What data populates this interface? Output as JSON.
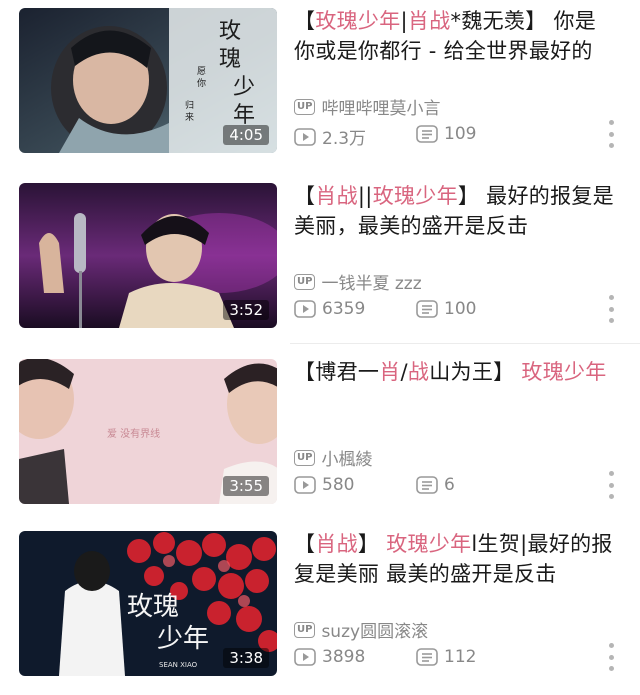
{
  "videos": [
    {
      "title_parts": [
        {
          "text": "【",
          "hl": false
        },
        {
          "text": "玫瑰少年",
          "hl": true
        },
        {
          "text": "|",
          "hl": false
        },
        {
          "text": "肖战",
          "hl": true
        },
        {
          "text": "*魏无羡】 你是你或是你都行 - 给全世界最好的",
          "hl": false
        }
      ],
      "duration": "4:05",
      "uploader": "哔哩哔哩莫小言",
      "views": "2.3万",
      "danmaku": "109",
      "thumb_text": "玫瑰少年",
      "thumb_subtext": "愿你历经万千 归来仍是少年"
    },
    {
      "title_parts": [
        {
          "text": "【",
          "hl": false
        },
        {
          "text": "肖战",
          "hl": true
        },
        {
          "text": "||",
          "hl": false
        },
        {
          "text": "玫瑰少年",
          "hl": true
        },
        {
          "text": "】 最好的报复是美丽，最美的盛开是反击",
          "hl": false
        }
      ],
      "duration": "3:52",
      "uploader": "一钱半夏 zzz",
      "views": "6359",
      "danmaku": "100"
    },
    {
      "title_parts": [
        {
          "text": "【博君一",
          "hl": false
        },
        {
          "text": "肖",
          "hl": true
        },
        {
          "text": "/",
          "hl": false
        },
        {
          "text": "战",
          "hl": true
        },
        {
          "text": "山为王】 ",
          "hl": false
        },
        {
          "text": "玫瑰少年",
          "hl": true
        }
      ],
      "duration": "3:55",
      "uploader": "小楓綾",
      "views": "580",
      "danmaku": "6",
      "thumb_text": "爱   没有界线"
    },
    {
      "title_parts": [
        {
          "text": "【",
          "hl": false
        },
        {
          "text": "肖战",
          "hl": true
        },
        {
          "text": "】 ",
          "hl": false
        },
        {
          "text": "玫瑰少年",
          "hl": true
        },
        {
          "text": "l生贺|最好的报复是美丽 最美的盛开是反击",
          "hl": false
        }
      ],
      "duration": "3:38",
      "uploader": "suzy圆圆滚滚",
      "views": "3898",
      "danmaku": "112",
      "thumb_text": "玫瑰少年",
      "thumb_subtext": "SEAN XIAO"
    }
  ],
  "labels": {
    "up_badge": "UP"
  },
  "colors": {
    "highlight": "#d9657f",
    "meta": "#888888"
  },
  "icons": {
    "views": "play-count-icon",
    "danmaku": "danmaku-icon",
    "more": "more-vertical-icon"
  }
}
